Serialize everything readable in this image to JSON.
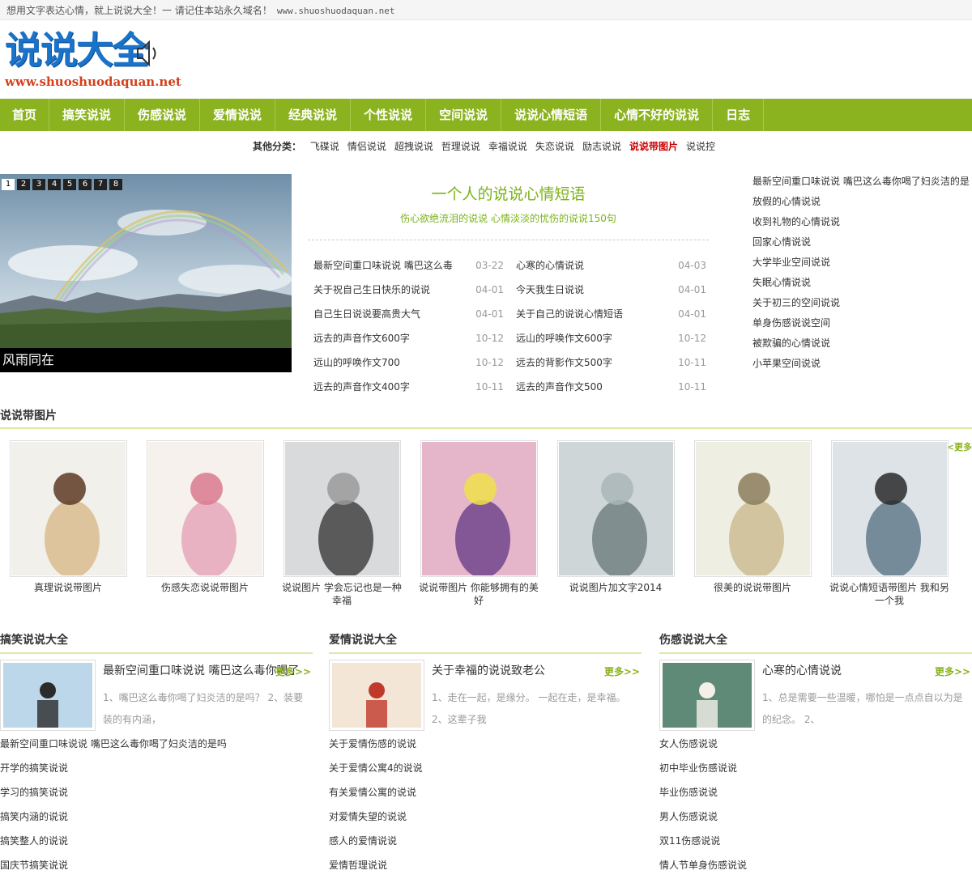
{
  "topbar": {
    "notice": "想用文字表达心情，就上说说大全！一 请记住本站永久域名！",
    "url": "www.shuoshuodaquan.net"
  },
  "logo": {
    "title": "说说大全",
    "domain": "www.shuoshuodaquan.net"
  },
  "nav": [
    "首页",
    "搞笑说说",
    "伤感说说",
    "爱情说说",
    "经典说说",
    "个性说说",
    "空间说说",
    "说说心情短语",
    "心情不好的说说",
    "日志"
  ],
  "subcats": {
    "label": "其他分类：",
    "items": [
      "飞碟说",
      "情侣说说",
      "超拽说说",
      "哲理说说",
      "幸福说说",
      "失恋说说",
      "励志说说",
      "说说带图片",
      "说说控"
    ],
    "highlight_index": 7
  },
  "slider": {
    "pages": [
      "1",
      "2",
      "3",
      "4",
      "5",
      "6",
      "7",
      "8"
    ],
    "active": 0,
    "caption": "风雨同在"
  },
  "featured": {
    "title": "一个人的说说心情短语",
    "subtitle": "伤心欲绝流泪的说说  心情淡淡的忧伤的说说150句",
    "left": [
      {
        "title": "最新空间重口味说说  嘴巴这么毒",
        "date": "03-22"
      },
      {
        "title": "关于祝自己生日快乐的说说",
        "date": "04-01"
      },
      {
        "title": "自己生日说说要高贵大气",
        "date": "04-01"
      },
      {
        "title": "远去的声音作文600字",
        "date": "10-12"
      },
      {
        "title": "远山的呼唤作文700",
        "date": "10-12"
      },
      {
        "title": "远去的声音作文400字",
        "date": "10-11"
      }
    ],
    "right": [
      {
        "title": "心寒的心情说说",
        "date": "04-03"
      },
      {
        "title": "今天我生日说说",
        "date": "04-01"
      },
      {
        "title": "关于自己的说说心情短语",
        "date": "04-01"
      },
      {
        "title": "远山的呼唤作文600字",
        "date": "10-12"
      },
      {
        "title": "远去的背影作文500字",
        "date": "10-11"
      },
      {
        "title": "远去的声音作文500",
        "date": "10-11"
      }
    ]
  },
  "right_list": [
    "最新空间重口味说说  嘴巴这么毒你喝了妇炎洁的是",
    "放假的心情说说",
    "收到礼物的心情说说",
    "回家心情说说",
    "大学毕业空间说说",
    "失眠心情说说",
    "关于初三的空间说说",
    "单身伤感说说空间",
    "被欺骗的心情说说",
    "小苹果空间说说"
  ],
  "gallery": {
    "title": "说说带图片",
    "more": "更多>>",
    "items": [
      "真理说说带图片",
      "伤感失恋说说带图片",
      "说说图片  学会忘记也是一种幸福",
      "说说带图片  你能够拥有的美好",
      "说说图片加文字2014",
      "很美的说说带图片",
      "说说心情短语带图片  我和另一个我"
    ]
  },
  "columns": [
    {
      "title": "搞笑说说大全",
      "more": "更多>>",
      "feature_title": "最新空间重口味说说  嘴巴这么毒你喝了",
      "feature_excerpt": "1、嘴巴这么毒你喝了妇炎洁的是吗？ 2、装要装的有内涵，",
      "list": [
        "最新空间重口味说说  嘴巴这么毒你喝了妇炎洁的是吗",
        "开学的搞笑说说",
        "学习的搞笑说说",
        "搞笑内涵的说说",
        "搞笑整人的说说",
        "国庆节搞笑说说"
      ]
    },
    {
      "title": "爱情说说大全",
      "more": "更多>>",
      "feature_title": "关于幸福的说说致老公",
      "feature_excerpt": "1、走在一起，是缘分。 一起在走，是幸福。 2、这辈子我",
      "list": [
        "关于爱情伤感的说说",
        "关于爱情公寓4的说说",
        "有关爱情公寓的说说",
        "对爱情失望的说说",
        "感人的爱情说说",
        "爱情哲理说说"
      ]
    },
    {
      "title": "伤感说说大全",
      "more": "更多>>",
      "feature_title": "心寒的心情说说",
      "feature_excerpt": "1、总是需要一些温暖，哪怕是一点点自以为是的纪念。 2、",
      "list": [
        "女人伤感说说",
        "初中毕业伤感说说",
        "毕业伤感说说",
        "男人伤感说说",
        "双11伤感说说",
        "情人节单身伤感说说"
      ]
    }
  ]
}
